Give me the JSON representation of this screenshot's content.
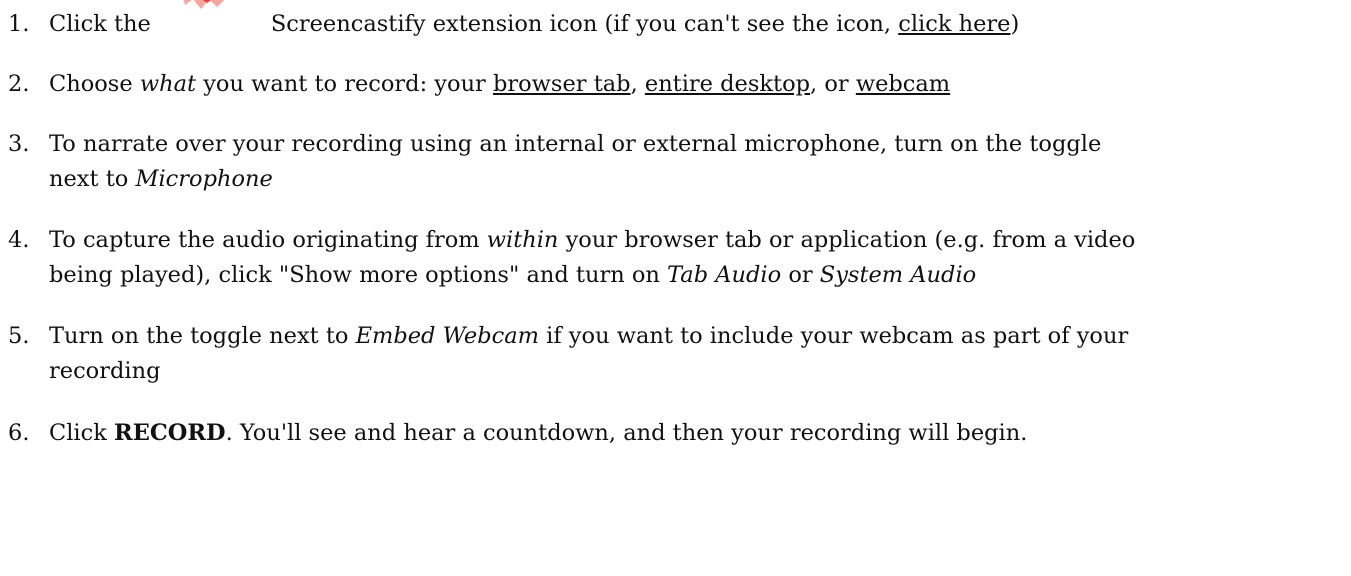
{
  "steps": [
    {
      "number": "1.",
      "text_a": "Click the",
      "icon": "screencastify-extension-icon",
      "text_b": "Screencastify extension icon (if you can't see the icon, ",
      "link": "click here",
      "text_c": ")"
    },
    {
      "number": "2.",
      "text_a": "Choose ",
      "em": "what",
      "text_b": " you want to record: your ",
      "link_1": "browser tab",
      "sep_1": ", ",
      "link_2": "entire desktop",
      "sep_2": ", or ",
      "link_3": "webcam"
    },
    {
      "number": "3.",
      "line_1": "To narrate over your recording using an internal or external microphone, turn on the toggle",
      "text_a": "next to ",
      "em": "Microphone"
    },
    {
      "number": "4.",
      "text_a": "To capture the audio originating from ",
      "em_1": "within",
      "text_b": " your browser tab or application (e.g. from a video",
      "text_c": "being played), click \"Show more options\" and turn on ",
      "em_2": "Tab Audio",
      "text_d": " or ",
      "em_3": "System Audio"
    },
    {
      "number": "5.",
      "text_a": "Turn on the toggle next to ",
      "em": "Embed Webcam",
      "text_b": " if you want to include your webcam as part of your",
      "line_2": "recording"
    },
    {
      "number": "6.",
      "text_a": "Click ",
      "strong": "RECORD",
      "text_b": ". You'll see and hear a countdown, and then your recording will begin."
    }
  ],
  "colors": {
    "text": "#111111",
    "icon_red": "#e8423a",
    "icon_light": "#f4a6a0"
  }
}
